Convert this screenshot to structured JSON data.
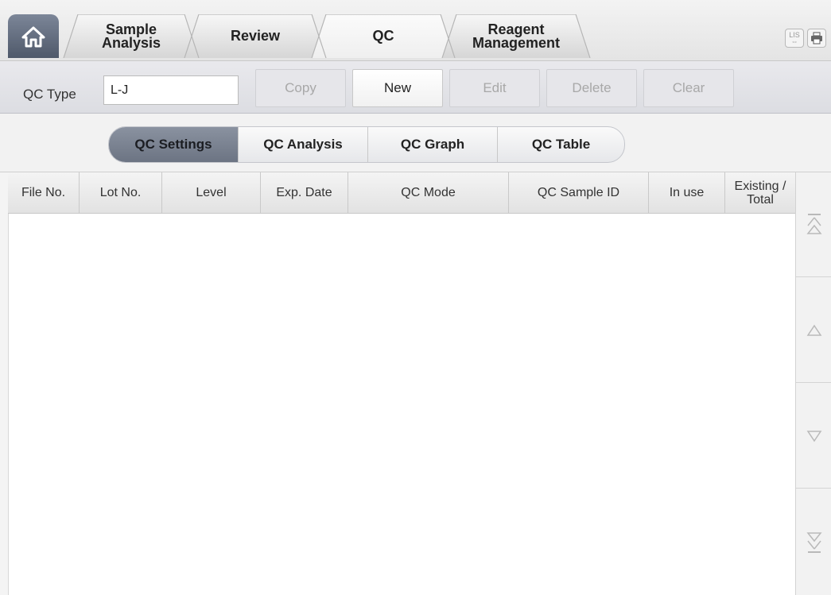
{
  "tabs": [
    {
      "label_line1": "Sample",
      "label_line2": "Analysis"
    },
    {
      "label_line1": "Review",
      "label_line2": ""
    },
    {
      "label_line1": "QC",
      "label_line2": ""
    },
    {
      "label_line1": "Reagent",
      "label_line2": "Management"
    }
  ],
  "top_icons": {
    "lis_line1": "LIS",
    "lis_line2": "⇔"
  },
  "toolbar": {
    "qc_type_label": "QC Type",
    "qc_type_value": "L-J",
    "copy": "Copy",
    "new": "New",
    "edit": "Edit",
    "delete": "Delete",
    "clear": "Clear"
  },
  "subtabs": [
    "QC Settings",
    "QC Analysis",
    "QC Graph",
    "QC Table"
  ],
  "table": {
    "columns": [
      "File No.",
      "Lot No.",
      "Level",
      "Exp. Date",
      "QC Mode",
      "QC Sample ID",
      "In use"
    ],
    "last_col_line1": "Existing /",
    "last_col_line2": "Total",
    "rows": []
  },
  "colors": {
    "active_home": "#5f6878",
    "active_segment": "#7a8291",
    "accent": "#4f596a"
  },
  "icons": [
    "home-icon",
    "lis-icon",
    "printer-icon",
    "scroll-top-icon",
    "scroll-up-icon",
    "scroll-down-icon",
    "scroll-bottom-icon"
  ]
}
